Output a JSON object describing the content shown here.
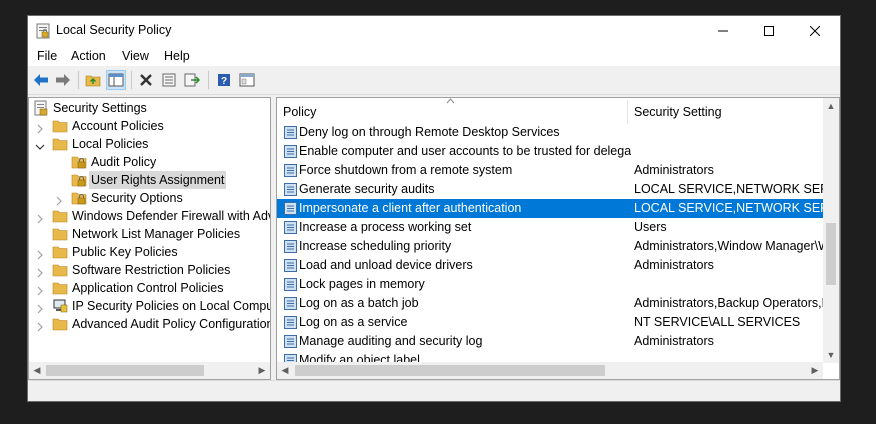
{
  "window": {
    "title": "Local Security Policy"
  },
  "menu": [
    "File",
    "Action",
    "View",
    "Help"
  ],
  "toolbar_icons": [
    "back-arrow-icon",
    "forward-arrow-icon",
    "up-folder-icon",
    "show-hide-tree-icon",
    "delete-icon",
    "properties-icon",
    "export-list-icon",
    "help-icon",
    "console-view-icon"
  ],
  "tree": {
    "root": "Security Settings",
    "nodes": [
      {
        "label": "Account Policies",
        "level": 1,
        "expander": "collapsed",
        "icon": "folder"
      },
      {
        "label": "Local Policies",
        "level": 1,
        "expander": "expanded",
        "icon": "folder"
      },
      {
        "label": "Audit Policy",
        "level": 2,
        "expander": "none",
        "icon": "folder"
      },
      {
        "label": "User Rights Assignment",
        "level": 2,
        "expander": "none",
        "icon": "folder",
        "selected": true
      },
      {
        "label": "Security Options",
        "level": 2,
        "expander": "collapsed",
        "icon": "folder"
      },
      {
        "label": "Windows Defender Firewall with Adva",
        "level": 1,
        "expander": "collapsed",
        "icon": "folder"
      },
      {
        "label": "Network List Manager Policies",
        "level": 1,
        "expander": "none",
        "icon": "folder"
      },
      {
        "label": "Public Key Policies",
        "level": 1,
        "expander": "collapsed",
        "icon": "folder"
      },
      {
        "label": "Software Restriction Policies",
        "level": 1,
        "expander": "collapsed",
        "icon": "folder"
      },
      {
        "label": "Application Control Policies",
        "level": 1,
        "expander": "collapsed",
        "icon": "folder"
      },
      {
        "label": "IP Security Policies on Local Compute",
        "level": 1,
        "expander": "collapsed",
        "icon": "ipsec"
      },
      {
        "label": "Advanced Audit Policy Configuration",
        "level": 1,
        "expander": "collapsed",
        "icon": "folder"
      }
    ]
  },
  "list": {
    "columns": [
      "Policy",
      "Security Setting"
    ],
    "rows": [
      {
        "policy": "Deny log on through Remote Desktop Services",
        "setting": ""
      },
      {
        "policy": "Enable computer and user accounts to be trusted for delega...",
        "setting": ""
      },
      {
        "policy": "Force shutdown from a remote system",
        "setting": "Administrators"
      },
      {
        "policy": "Generate security audits",
        "setting": "LOCAL SERVICE,NETWORK SERVICE"
      },
      {
        "policy": "Impersonate a client after authentication",
        "setting": "LOCAL SERVICE,NETWORK SERVICE,",
        "selected": true
      },
      {
        "policy": "Increase a process working set",
        "setting": "Users"
      },
      {
        "policy": "Increase scheduling priority",
        "setting": "Administrators,Window Manager\\W"
      },
      {
        "policy": "Load and unload device drivers",
        "setting": "Administrators"
      },
      {
        "policy": "Lock pages in memory",
        "setting": ""
      },
      {
        "policy": "Log on as a batch job",
        "setting": "Administrators,Backup Operators,Pe"
      },
      {
        "policy": "Log on as a service",
        "setting": "NT SERVICE\\ALL SERVICES"
      },
      {
        "policy": "Manage auditing and security log",
        "setting": "Administrators"
      },
      {
        "policy": "Modify an object label",
        "setting": ""
      }
    ]
  },
  "colors": {
    "selection": "#0078d7",
    "folder": "#e8b84a",
    "lock": "#c99a1a"
  }
}
